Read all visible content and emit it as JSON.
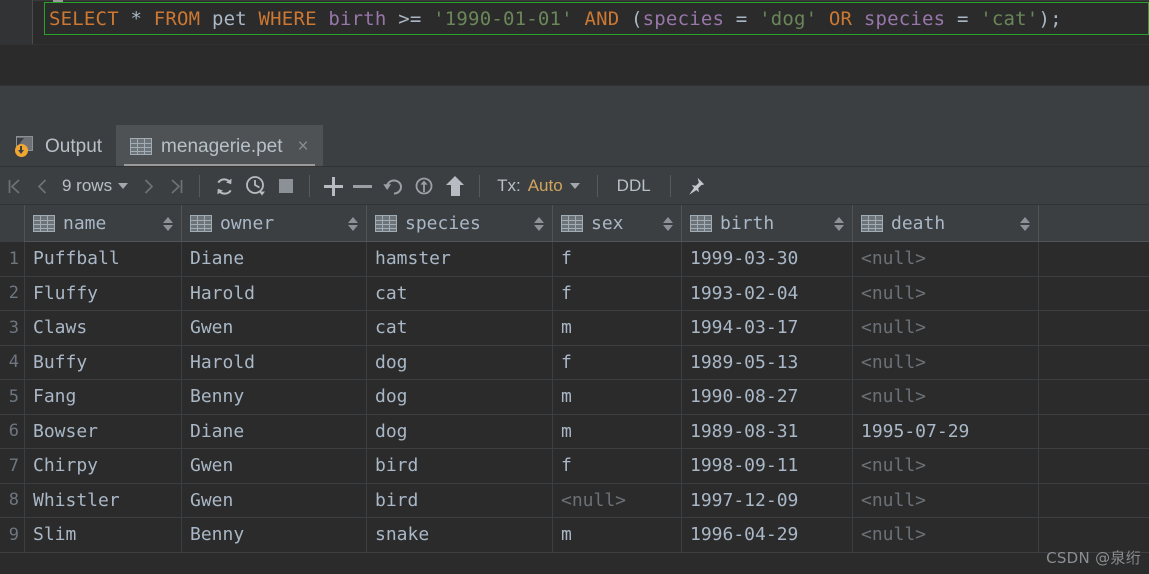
{
  "editor": {
    "sql_tokens": [
      {
        "t": "SELECT",
        "k": "kw"
      },
      {
        "t": " ",
        "k": "sp"
      },
      {
        "t": "*",
        "k": "op"
      },
      {
        "t": " ",
        "k": "sp"
      },
      {
        "t": "FROM",
        "k": "kw"
      },
      {
        "t": " ",
        "k": "sp"
      },
      {
        "t": "pet",
        "k": "tbl"
      },
      {
        "t": " ",
        "k": "sp"
      },
      {
        "t": "WHERE",
        "k": "kw"
      },
      {
        "t": " ",
        "k": "sp"
      },
      {
        "t": "birth",
        "k": "col"
      },
      {
        "t": " ",
        "k": "sp"
      },
      {
        "t": ">=",
        "k": "op"
      },
      {
        "t": " ",
        "k": "sp"
      },
      {
        "t": "'1990-01-01'",
        "k": "str"
      },
      {
        "t": " ",
        "k": "sp"
      },
      {
        "t": "AND",
        "k": "kw"
      },
      {
        "t": " ",
        "k": "sp"
      },
      {
        "t": "(",
        "k": "par"
      },
      {
        "t": "species",
        "k": "col"
      },
      {
        "t": " ",
        "k": "sp"
      },
      {
        "t": "=",
        "k": "op"
      },
      {
        "t": " ",
        "k": "sp"
      },
      {
        "t": "'dog'",
        "k": "str"
      },
      {
        "t": " ",
        "k": "sp"
      },
      {
        "t": "OR",
        "k": "kw"
      },
      {
        "t": " ",
        "k": "sp"
      },
      {
        "t": "species",
        "k": "col"
      },
      {
        "t": " ",
        "k": "sp"
      },
      {
        "t": "=",
        "k": "op"
      },
      {
        "t": " ",
        "k": "sp"
      },
      {
        "t": "'cat'",
        "k": "str"
      },
      {
        "t": ")",
        "k": "par"
      },
      {
        "t": ";",
        "k": "semi"
      }
    ],
    "sql_text": "SELECT * FROM pet WHERE birth >= '1990-01-01' AND (species = 'dog' OR species = 'cat');",
    "highlight_color": "#27a327"
  },
  "tabs": [
    {
      "label": "Output",
      "icon": "output-icon",
      "active": false,
      "closable": false
    },
    {
      "label": "menagerie.pet",
      "icon": "grid-icon",
      "active": true,
      "closable": true,
      "close_glyph": "×"
    }
  ],
  "toolbar": {
    "first_page": "⏮",
    "prev_page": "‹",
    "rows_label": "9 rows",
    "next_page": "›",
    "last_page": "⏭",
    "reload_icon": "refresh-icon",
    "history_icon": "history-clock-icon",
    "stop_icon": "stop-icon",
    "add_row_icon": "plus-icon",
    "delete_row_icon": "minus-icon",
    "revert_icon": "revert-arrow-icon",
    "revert_selected_icon": "revert-selected-icon",
    "submit_icon": "upload-arrow-icon",
    "tx_prefix": "Tx:",
    "tx_value": "Auto",
    "ddl_label": "DDL",
    "pin_icon": "pin-icon"
  },
  "grid": {
    "columns": [
      {
        "name": "name",
        "icon": "column-icon",
        "width_class": "w-name"
      },
      {
        "name": "owner",
        "icon": "column-icon",
        "width_class": "w-owner"
      },
      {
        "name": "species",
        "icon": "column-icon",
        "width_class": "w-species"
      },
      {
        "name": "sex",
        "icon": "column-icon",
        "width_class": "w-sex"
      },
      {
        "name": "birth",
        "icon": "column-icon",
        "width_class": "w-birth"
      },
      {
        "name": "death",
        "icon": "column-icon",
        "width_class": "w-death"
      }
    ],
    "null_text": "<null>",
    "rows": [
      {
        "n": "1",
        "name": "Puffball",
        "owner": "Diane",
        "species": "hamster",
        "sex": "f",
        "birth": "1999-03-30",
        "death": "<null>"
      },
      {
        "n": "2",
        "name": "Fluffy",
        "owner": "Harold",
        "species": "cat",
        "sex": "f",
        "birth": "1993-02-04",
        "death": "<null>"
      },
      {
        "n": "3",
        "name": "Claws",
        "owner": "Gwen",
        "species": "cat",
        "sex": "m",
        "birth": "1994-03-17",
        "death": "<null>"
      },
      {
        "n": "4",
        "name": "Buffy",
        "owner": "Harold",
        "species": "dog",
        "sex": "f",
        "birth": "1989-05-13",
        "death": "<null>"
      },
      {
        "n": "5",
        "name": "Fang",
        "owner": "Benny",
        "species": "dog",
        "sex": "m",
        "birth": "1990-08-27",
        "death": "<null>"
      },
      {
        "n": "6",
        "name": "Bowser",
        "owner": "Diane",
        "species": "dog",
        "sex": "m",
        "birth": "1989-08-31",
        "death": "1995-07-29"
      },
      {
        "n": "7",
        "name": "Chirpy",
        "owner": "Gwen",
        "species": "bird",
        "sex": "f",
        "birth": "1998-09-11",
        "death": "<null>"
      },
      {
        "n": "8",
        "name": "Whistler",
        "owner": "Gwen",
        "species": "bird",
        "sex": "<null>",
        "birth": "1997-12-09",
        "death": "<null>"
      },
      {
        "n": "9",
        "name": "Slim",
        "owner": "Benny",
        "species": "snake",
        "sex": "m",
        "birth": "1996-04-29",
        "death": "<null>"
      }
    ]
  },
  "watermark": {
    "text": "CSDN @泉绗"
  },
  "colors": {
    "editor_bg": "#2b2b2b",
    "panel_bg": "#3c3f41",
    "text": "#a9b7c6",
    "keyword": "#cc7832",
    "string": "#6a8759",
    "column": "#9876aa",
    "null": "#6b7177",
    "accent_green": "#27a327"
  }
}
